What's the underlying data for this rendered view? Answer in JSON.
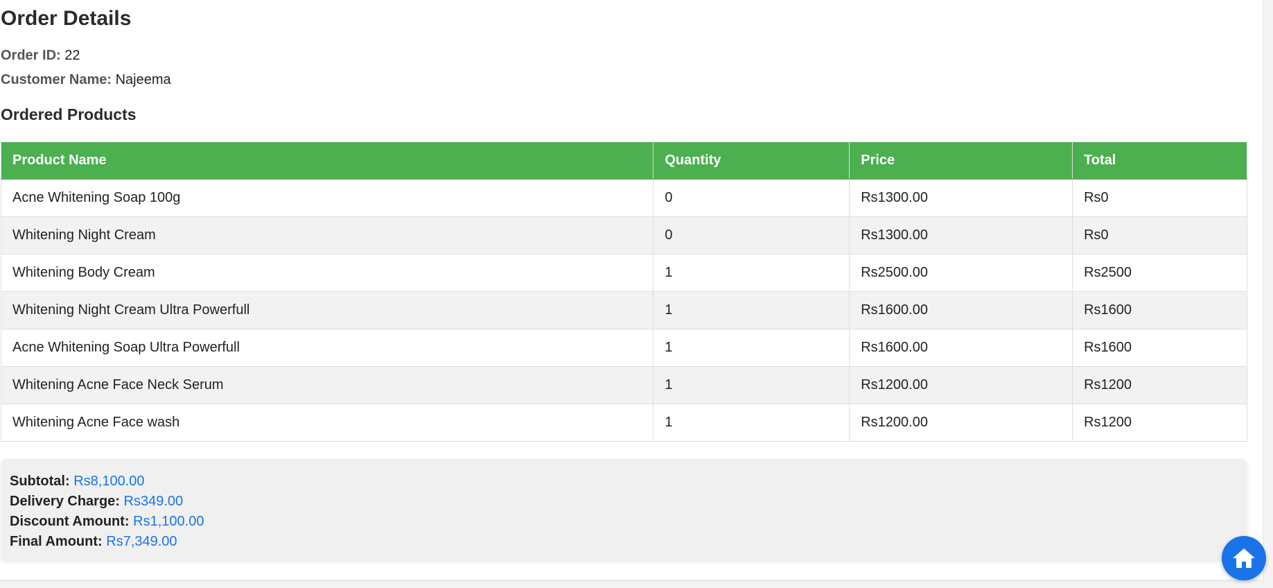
{
  "page": {
    "title": "Order Details",
    "order_id_label": "Order ID:",
    "order_id": "22",
    "customer_label": "Customer Name:",
    "customer_name": "Najeema",
    "products_heading": "Ordered Products"
  },
  "table": {
    "headers": [
      "Product Name",
      "Quantity",
      "Price",
      "Total"
    ],
    "rows": [
      [
        "Acne Whitening Soap 100g",
        "0",
        "Rs1300.00",
        "Rs0"
      ],
      [
        "Whitening Night Cream",
        "0",
        "Rs1300.00",
        "Rs0"
      ],
      [
        "Whitening Body Cream",
        "1",
        "Rs2500.00",
        "Rs2500"
      ],
      [
        "Whitening Night Cream Ultra Powerfull",
        "1",
        "Rs1600.00",
        "Rs1600"
      ],
      [
        "Acne Whitening Soap Ultra Powerfull",
        "1",
        "Rs1600.00",
        "Rs1600"
      ],
      [
        "Whitening Acne Face Neck Serum",
        "1",
        "Rs1200.00",
        "Rs1200"
      ],
      [
        "Whitening Acne Face wash",
        "1",
        "Rs1200.00",
        "Rs1200"
      ]
    ]
  },
  "summary": {
    "subtotal_label": "Subtotal:",
    "subtotal": "Rs8,100.00",
    "delivery_label": "Delivery Charge:",
    "delivery": "Rs349.00",
    "discount_label": "Discount Amount:",
    "discount": "Rs1,100.00",
    "final_label": "Final Amount:",
    "final": "Rs7,349.00"
  },
  "home_button": {
    "icon": "home-icon"
  },
  "colors": {
    "header_green": "#4caf50",
    "accent_blue": "#1a73e8",
    "stripe_gray": "#f2f2f2"
  }
}
